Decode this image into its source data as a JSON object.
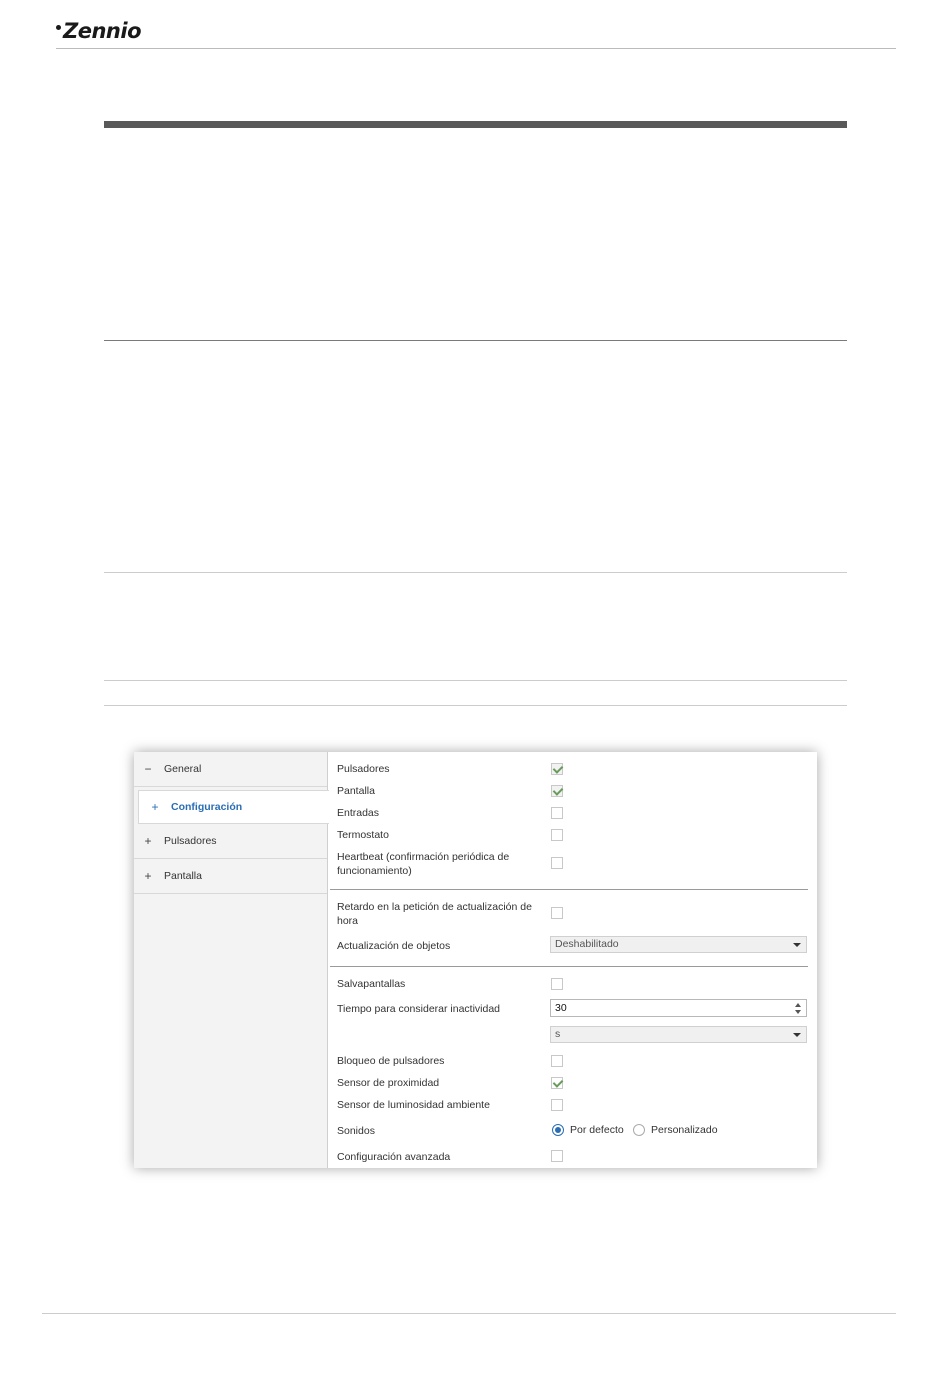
{
  "header": {
    "brand": "Zennio"
  },
  "tree": {
    "items": [
      {
        "sign": "−",
        "label": "General"
      },
      {
        "sign": "+",
        "label": "Configuración"
      },
      {
        "sign": "+",
        "label": "Pulsadores"
      },
      {
        "sign": "+",
        "label": "Pantalla"
      }
    ]
  },
  "panel": {
    "pulsadores": {
      "label": "Pulsadores",
      "checked": true
    },
    "pantalla": {
      "label": "Pantalla",
      "checked": true
    },
    "entradas": {
      "label": "Entradas",
      "checked": false
    },
    "termostato": {
      "label": "Termostato",
      "checked": false
    },
    "heartbeat": {
      "label1": "Heartbeat (confirmación periódica de",
      "label2": "funcionamiento)",
      "checked": false
    },
    "retardo": {
      "label1": "Retardo en la petición de actualización de",
      "label2": "hora",
      "checked": false
    },
    "actualizacion": {
      "label": "Actualización de objetos",
      "value": "Deshabilitado"
    },
    "salvapantallas": {
      "label": "Salvapantallas",
      "checked": false
    },
    "tiempo": {
      "label": "Tiempo para considerar inactividad",
      "value": "30",
      "unit": "s"
    },
    "bloqueo": {
      "label": "Bloqueo de pulsadores",
      "checked": false
    },
    "proximidad": {
      "label": "Sensor de proximidad",
      "checked": true
    },
    "luminosidad": {
      "label": "Sensor de luminosidad ambiente",
      "checked": false
    },
    "sonidos": {
      "label": "Sonidos",
      "option1": "Por defecto",
      "option2": "Personalizado",
      "selected": "Por defecto"
    },
    "avanzada": {
      "label": "Configuración avanzada",
      "checked": false
    }
  }
}
